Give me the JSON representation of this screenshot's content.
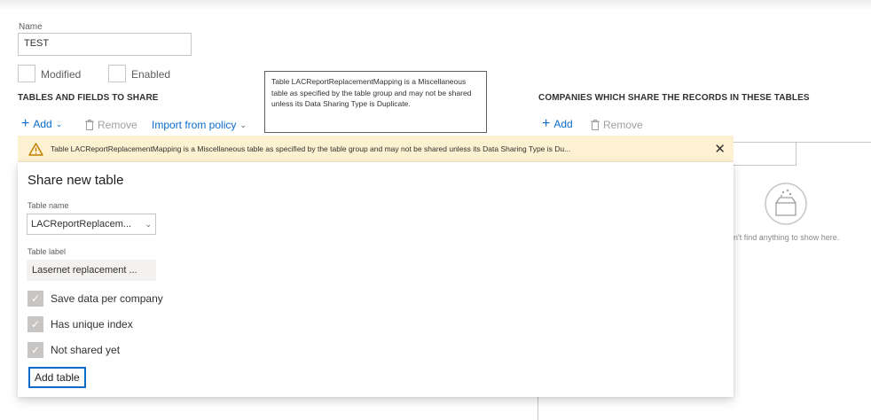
{
  "form": {
    "name_label": "Name",
    "name_value": "TEST",
    "modified_label": "Modified",
    "enabled_label": "Enabled"
  },
  "tables_section": {
    "heading": "TABLES AND FIELDS TO SHARE",
    "add_label": "Add",
    "remove_label": "Remove",
    "import_label": "Import from policy"
  },
  "tooltip": {
    "text": "Table LACReportReplacementMapping is a Miscellaneous table as specified by the table group and may not be shared unless its Data Sharing Type is Duplicate."
  },
  "companies_section": {
    "heading": "COMPANIES WHICH SHARE THE RECORDS IN THESE TABLES",
    "add_label": "Add",
    "remove_label": "Remove",
    "empty_text": "dn't find anything to show here."
  },
  "warning": {
    "text": "Table LACReportReplacementMapping is a Miscellaneous table as specified by the table group and may not be shared unless its Data Sharing Type is Du..."
  },
  "dialog": {
    "title": "Share new table",
    "table_name_label": "Table name",
    "table_name_value": "LACReportReplacem...",
    "table_label_label": "Table label",
    "table_label_value": "Lasernet replacement ...",
    "checkboxes": [
      {
        "label": "Save data per company",
        "checked": true
      },
      {
        "label": "Has unique index",
        "checked": true
      },
      {
        "label": "Not shared yet",
        "checked": true
      }
    ],
    "add_table_label": "Add table"
  },
  "colors": {
    "accent": "#0b6bc9",
    "warning_bg": "#fcf1d0",
    "warning_icon": "#c27c00"
  }
}
